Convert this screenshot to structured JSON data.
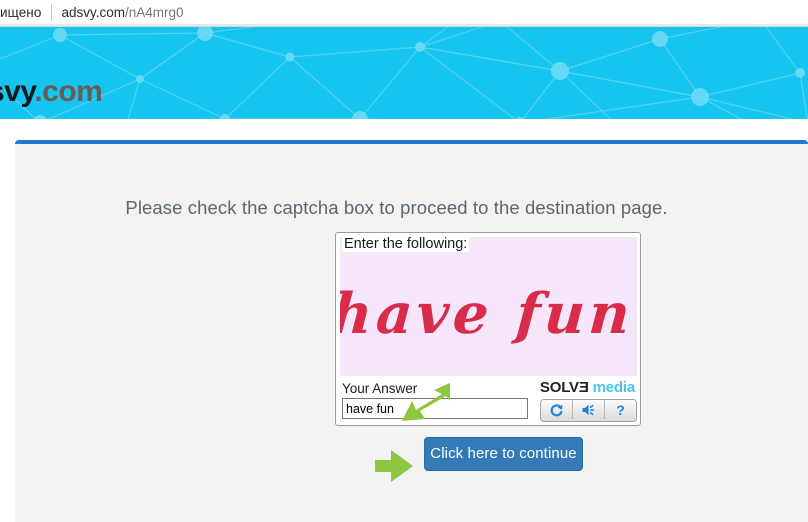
{
  "browser": {
    "secure_label": "ищено",
    "url_domain": "adsvy.com",
    "url_path": "/nA4mrg0"
  },
  "banner": {
    "logo_primary": "svy",
    "logo_secondary": ".com",
    "background_color": "#16c4f0",
    "node_color": "#63d8f7"
  },
  "page": {
    "accent_color": "#1e7ad2",
    "body_color": "#f3f3f3",
    "prompt": "Please check the captcha box to proceed to the destination page."
  },
  "captcha": {
    "instruction_label": "Enter the following:",
    "challenge_text": "have fun",
    "challenge_color": "#d92c4b",
    "challenge_background": "#f6e6fa",
    "answer_label": "Your Answer",
    "answer_value": "have fun",
    "answer_placeholder": "",
    "brand_solve": "SOLVE",
    "brand_media": "media",
    "buttons": [
      {
        "name": "refresh-captcha-button",
        "icon": "refresh-icon",
        "title": "Get a new challenge"
      },
      {
        "name": "audio-captcha-button",
        "icon": "speaker-icon",
        "title": "Get an audio challenge"
      },
      {
        "name": "help-captcha-button",
        "icon": "question-mark-icon",
        "label": "?",
        "title": "Help"
      }
    ]
  },
  "actions": {
    "continue_label": "Click here to continue",
    "continue_color": "#337ab7"
  },
  "annotations": {
    "arrow_color": "#8dc63f",
    "arrow_to_input": "arrow pointing at answer field",
    "arrow_to_button": "arrow pointing at continue button"
  }
}
